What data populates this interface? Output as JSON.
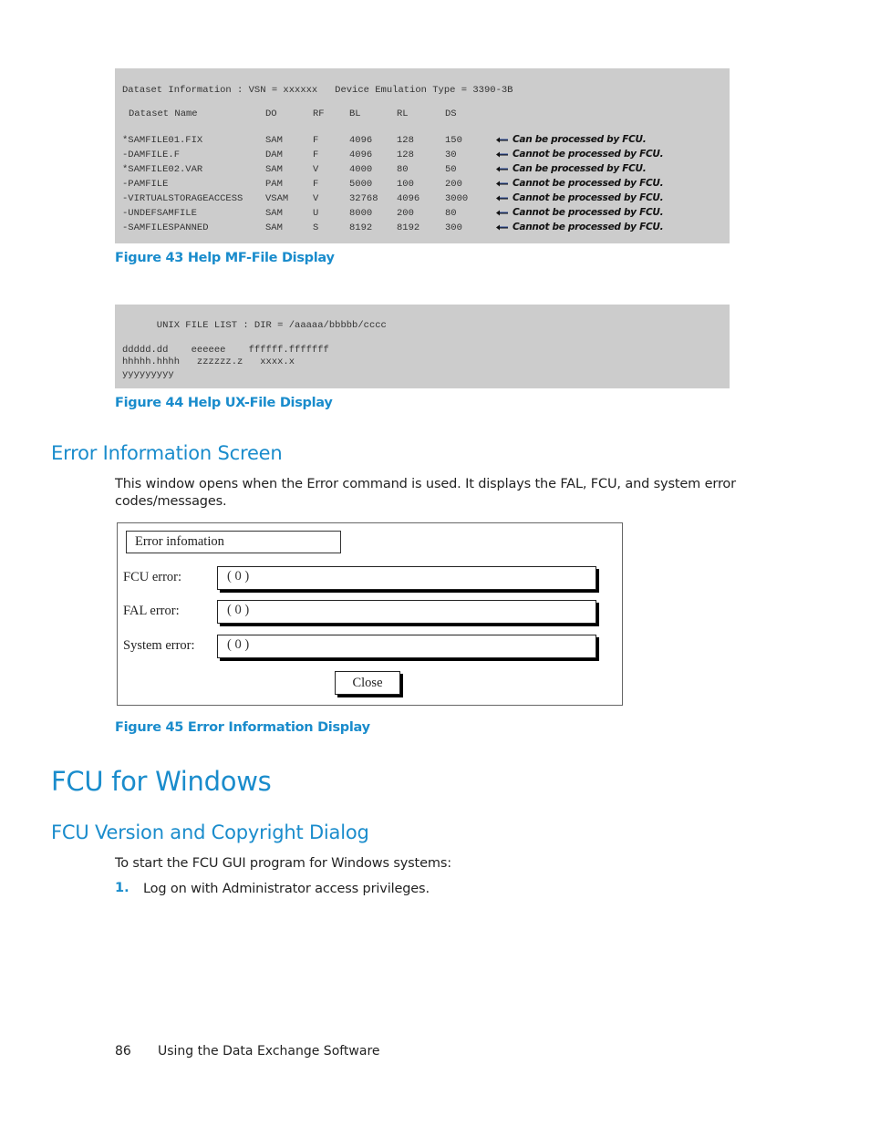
{
  "figure43": {
    "header_line": "Dataset Information : VSN = xxxxxx   Device Emulation Type = 3390-3B",
    "columns": [
      "Dataset Name",
      "DO",
      "RF",
      "BL",
      "RL",
      "DS"
    ],
    "rows": [
      {
        "name": "*SAMFILE01.FIX",
        "do": "SAM",
        "rf": "F",
        "bl": "4096",
        "rl": "128",
        "ds": "150",
        "note": "Can be processed by FCU."
      },
      {
        "name": "-DAMFILE.F",
        "do": "DAM",
        "rf": "F",
        "bl": "4096",
        "rl": "128",
        "ds": "30",
        "note": "Cannot be processed by FCU."
      },
      {
        "name": "*SAMFILE02.VAR",
        "do": "SAM",
        "rf": "V",
        "bl": "4000",
        "rl": "80",
        "ds": "50",
        "note": "Can be processed by FCU."
      },
      {
        "name": "-PAMFILE",
        "do": "PAM",
        "rf": "F",
        "bl": "5000",
        "rl": "100",
        "ds": "200",
        "note": "Cannot be processed by FCU."
      },
      {
        "name": "-VIRTUALSTORAGEACCESS",
        "do": "VSAM",
        "rf": "V",
        "bl": "32768",
        "rl": "4096",
        "ds": "3000",
        "note": "Cannot be processed by FCU."
      },
      {
        "name": "-UNDEFSAMFILE",
        "do": "SAM",
        "rf": "U",
        "bl": "8000",
        "rl": "200",
        "ds": "80",
        "note": "Cannot be processed by FCU."
      },
      {
        "name": "-SAMFILESPANNED",
        "do": "SAM",
        "rf": "S",
        "bl": "8192",
        "rl": "8192",
        "ds": "300",
        "note": "Cannot be processed by FCU."
      }
    ],
    "caption": "Figure 43 Help MF-File Display"
  },
  "figure44": {
    "header_line": "      UNIX FILE LIST : DIR = /aaaaa/bbbbb/cccc",
    "lines": [
      "ddddd.dd    eeeeee    ffffff.fffffff",
      "hhhhh.hhhh   zzzzzz.z   xxxx.x",
      "yyyyyyyyy"
    ],
    "caption": "Figure 44 Help UX-File Display"
  },
  "section_error": {
    "heading": "Error Information Screen",
    "paragraph_line1": "This window opens when the Error command is used. It displays the FAL, FCU, and system error",
    "paragraph_line2": "codes/messages."
  },
  "dialog": {
    "title": "Error infomation",
    "fields": [
      {
        "label": "FCU error:",
        "value": "(  0 )"
      },
      {
        "label": "FAL error:",
        "value": "(  0 )"
      },
      {
        "label": "System error:",
        "value": "(  0 )"
      }
    ],
    "close_label": "Close"
  },
  "figure45": {
    "caption": "Figure 45 Error Information Display"
  },
  "chapter": {
    "heading": "FCU for Windows"
  },
  "section_version": {
    "heading": "FCU Version and Copyright Dialog",
    "intro": "To start the FCU GUI program for Windows systems:",
    "steps": [
      {
        "num": "1.",
        "text": "Log on with Administrator access privileges."
      }
    ]
  },
  "footer": {
    "page_number": "86",
    "section_title": "Using the Data Exchange Software"
  },
  "colors": {
    "accent": "#1a8ccc",
    "code_background": "#cccccc"
  }
}
